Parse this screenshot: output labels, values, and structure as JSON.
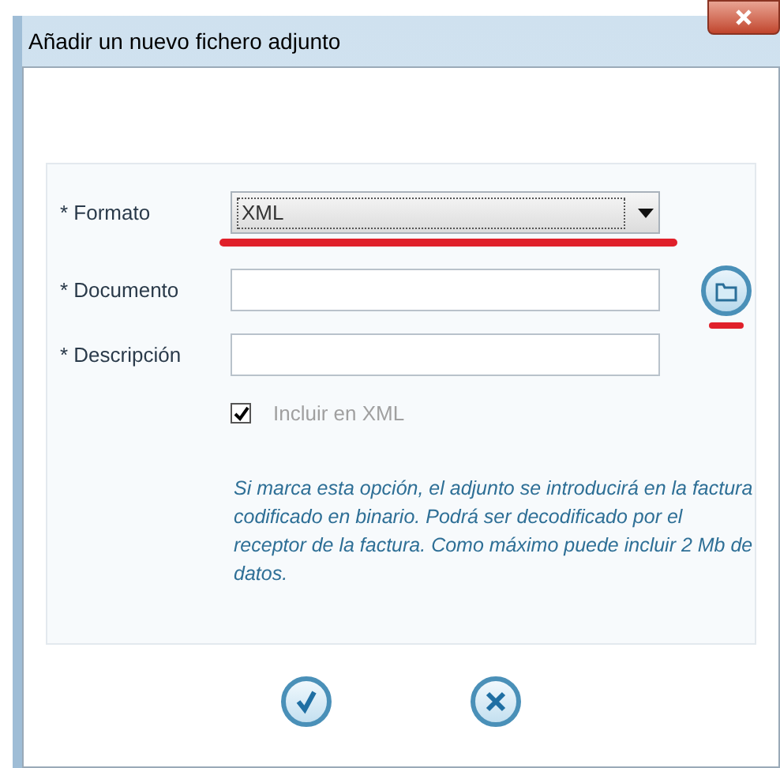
{
  "window": {
    "title": "Añadir un nuevo fichero adjunto"
  },
  "form": {
    "fields": [
      {
        "kind": "select",
        "label": "* Formato",
        "value": "XML",
        "marked": true
      },
      {
        "kind": "file",
        "label": "* Documento",
        "marked": false
      },
      {
        "kind": "text",
        "label": "* Descripción",
        "marked": false
      }
    ],
    "include_xml": {
      "label": "Incluir en XML",
      "checked": true,
      "disabled": true
    },
    "help_text": "Si marca esta opción, el adjunto se introducirá en la factura codificado en binario. Podrá ser decodificado por el receptor de la factura. Como máximo puede incluir 2 Mb de datos.",
    "browse_marked": true
  },
  "buttons": [
    {
      "kind": "ok"
    },
    {
      "kind": "cancel"
    }
  ]
}
